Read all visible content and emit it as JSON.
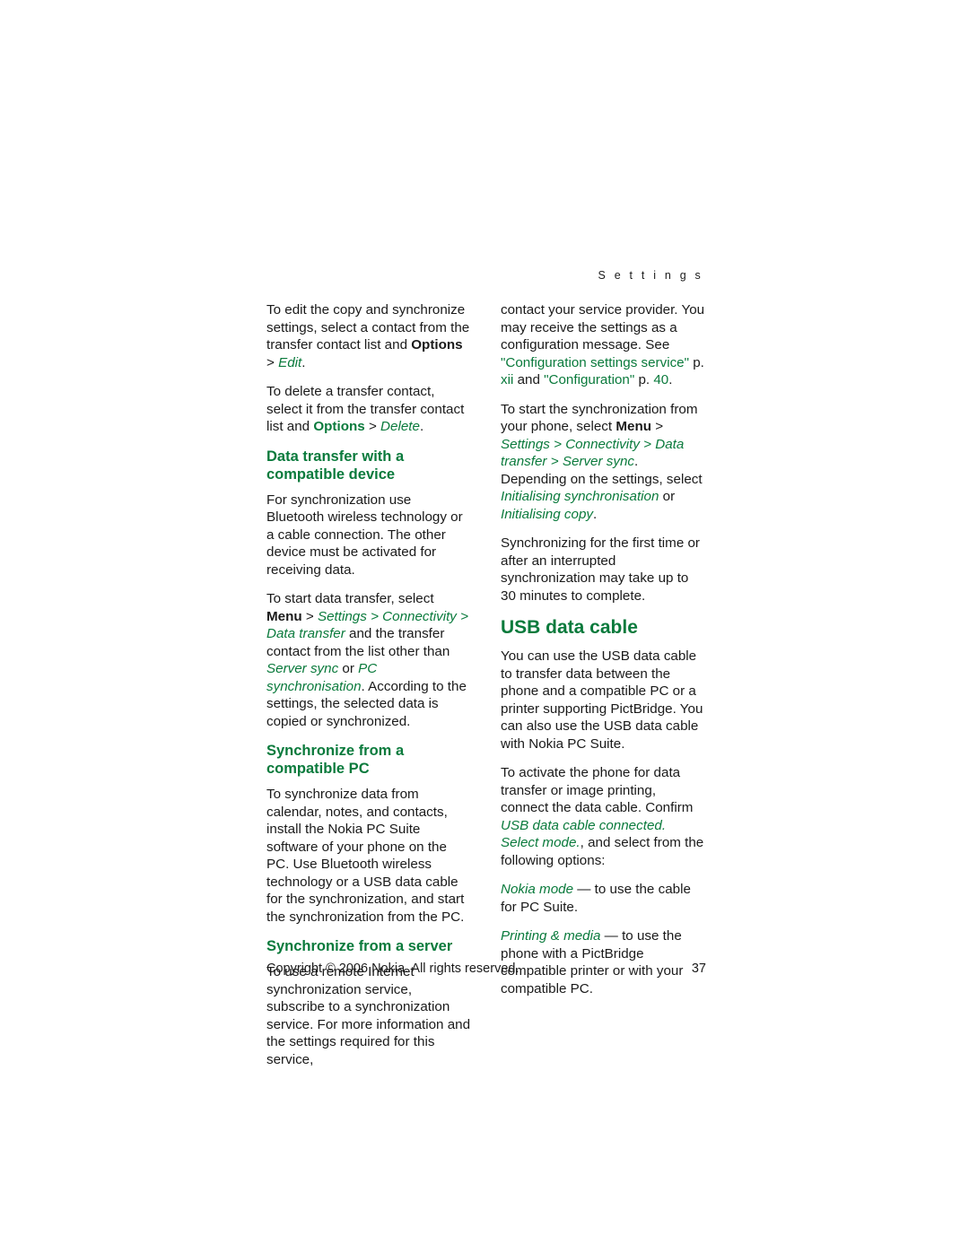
{
  "header": {
    "running_head": "S e t t i n g s"
  },
  "colors": {
    "accent_green": "#0a7a3c",
    "body_text": "#1a1a1a",
    "page_background": "#ffffff"
  },
  "left_column": {
    "p1": {
      "t1": "To edit the copy and synchronize settings, select a contact from the transfer contact list and ",
      "t2": "Options",
      "t3": " > ",
      "t4": "Edit",
      "t5": "."
    },
    "p2": {
      "t1": "To delete a transfer contact, select it from the transfer contact list and ",
      "t2": "Options",
      "t3": " > ",
      "t4": "Delete",
      "t5": "."
    },
    "h1": "Data transfer with a compatible device",
    "p3": "For synchronization use Bluetooth wireless technology or a cable connection. The other device must be activated for receiving data.",
    "p4": {
      "t1": "To start data transfer, select ",
      "t2": "Menu",
      "t3": " > ",
      "t4": "Settings",
      "t5": " > ",
      "t6": "Connectivity",
      "t7": " > ",
      "t8": "Data transfer",
      "t9": " and the transfer contact from the list other than ",
      "t10": "Server sync",
      "t11": " or ",
      "t12": "PC synchronisation",
      "t13": ". According to the settings, the selected data is copied or synchronized."
    },
    "h2": "Synchronize from a compatible PC",
    "p5": "To synchronize data from calendar, notes, and contacts, install the Nokia PC Suite software of your phone on the PC. Use Bluetooth wireless technology or a USB data cable for the synchronization, and start the synchronization from the PC.",
    "h3": "Synchronize from a server",
    "p6": "To use a remote Internet synchronization service, subscribe to a synchronization service. For more information and the settings required for this service,"
  },
  "right_column": {
    "p1": {
      "t1": "contact your service provider. You may receive the settings as a configuration message. See ",
      "t2": "\"Configuration settings service\"",
      "t3": " p. ",
      "t4": "xii",
      "t5": " and ",
      "t6": "\"Configuration\"",
      "t7": " p. ",
      "t8": "40",
      "t9": "."
    },
    "p2": {
      "t1": "To start the synchronization from your phone, select ",
      "t2": "Menu",
      "t3": " > ",
      "t4": "Settings",
      "t5": " > ",
      "t6": "Connectivity",
      "t7": " > ",
      "t8": "Data transfer",
      "t9": " > ",
      "t10": "Server sync",
      "t11": ". Depending on the settings, select ",
      "t12": "Initialising synchronisation",
      "t13": " or ",
      "t14": "Initialising copy",
      "t15": "."
    },
    "p3": "Synchronizing for the first time or after an interrupted synchronization may take up to 30 minutes to complete.",
    "h1": "USB data cable",
    "p4": "You can use the USB data cable to transfer data between the phone and a compatible PC or a printer supporting PictBridge. You can also use the USB data cable with Nokia PC Suite.",
    "p5": {
      "t1": "To activate the phone for data transfer or image printing, connect the data cable. Confirm ",
      "t2": "USB data cable connected. Select mode.",
      "t3": ", and select from the following options:"
    },
    "p6": {
      "t1": "Nokia mode",
      "t2": " — to use the cable for PC Suite."
    },
    "p7": {
      "t1": "Printing & media",
      "t2": " — to use the phone with a PictBridge compatible printer or with your compatible PC."
    }
  },
  "footer": {
    "copyright": "Copyright © 2006 Nokia. All rights reserved.",
    "page_number": "37"
  }
}
